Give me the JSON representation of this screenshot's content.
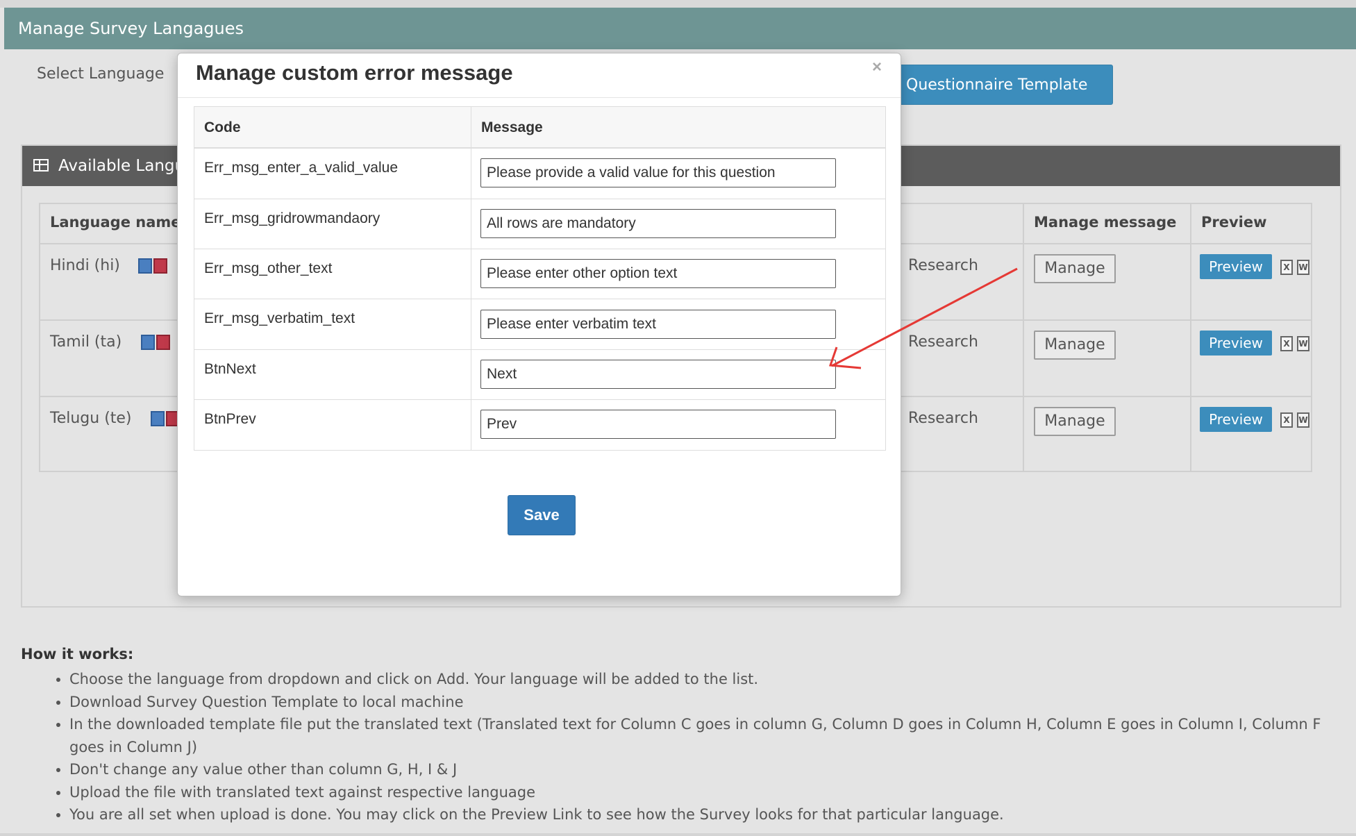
{
  "header": {
    "title": "Manage Survey Langagues"
  },
  "toolbar": {
    "select_language_label": "Select Language",
    "template_button_label": "Questionnaire Template"
  },
  "panel": {
    "title": "Available Langu",
    "columns": {
      "language_name": "Language name",
      "manage_message": "Manage message",
      "preview": "Preview"
    },
    "rows": [
      {
        "language": "Hindi (hi)",
        "source": "Research",
        "manage_label": "Manage",
        "preview_label": "Preview"
      },
      {
        "language": "Tamil (ta)",
        "source": "Research",
        "manage_label": "Manage",
        "preview_label": "Preview"
      },
      {
        "language": "Telugu (te)",
        "source": "Research",
        "manage_label": "Manage",
        "preview_label": "Preview"
      }
    ]
  },
  "how_it_works": {
    "title": "How it works:",
    "items": [
      "Choose the language from dropdown and click on Add. Your language will be added to the list.",
      "Download Survey Question Template to local machine",
      "In the downloaded template file put the translated text (Translated text for Column C goes in column G, Column D goes in Column H, Column E goes in Column I, Column F goes in Column J)",
      "Don't change any value other than column G, H, I & J",
      "Upload the file with translated text against respective language",
      "You are all set when upload is done. You may click on the Preview Link to see how the Survey looks for that particular language."
    ]
  },
  "modal": {
    "title": "Manage custom error message",
    "close_glyph": "×",
    "columns": {
      "code": "Code",
      "message": "Message"
    },
    "rows": [
      {
        "code": "Err_msg_enter_a_valid_value",
        "message": "Please provide a valid value for this question"
      },
      {
        "code": "Err_msg_gridrowmandaory",
        "message": "All rows are mandatory"
      },
      {
        "code": "Err_msg_other_text",
        "message": "Please enter other option text"
      },
      {
        "code": "Err_msg_verbatim_text",
        "message": "Please enter verbatim text"
      },
      {
        "code": "BtnNext",
        "message": "Next"
      },
      {
        "code": "BtnPrev",
        "message": "Prev"
      }
    ],
    "save_label": "Save"
  },
  "icons": {
    "table_icon": "grid-icon",
    "export_icons": [
      "copy-icon",
      "pdf-icon"
    ],
    "preview_icons": [
      "excel-icon",
      "word-icon"
    ],
    "annotation": "red-arrow"
  },
  "colors": {
    "header": "#6e9594",
    "accent": "#3c8dbc",
    "save": "#337ab7",
    "annotation": "#e53935"
  }
}
